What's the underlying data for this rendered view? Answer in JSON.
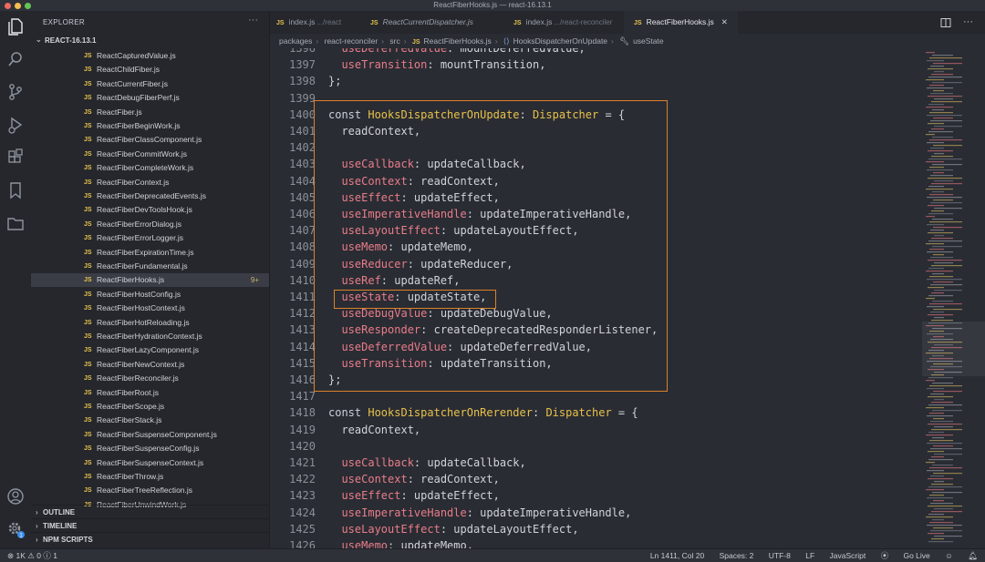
{
  "window": {
    "title": "ReactFiberHooks.js — react-16.13.1"
  },
  "sidebar": {
    "header": "EXPLORER",
    "folder": "REACT-16.13.1",
    "active_badge": "9+",
    "files": [
      "ReactCapturedValue.js",
      "ReactChildFiber.js",
      "ReactCurrentFiber.js",
      "ReactDebugFiberPerf.js",
      "ReactFiber.js",
      "ReactFiberBeginWork.js",
      "ReactFiberClassComponent.js",
      "ReactFiberCommitWork.js",
      "ReactFiberCompleteWork.js",
      "ReactFiberContext.js",
      "ReactFiberDeprecatedEvents.js",
      "ReactFiberDevToolsHook.js",
      "ReactFiberErrorDialog.js",
      "ReactFiberErrorLogger.js",
      "ReactFiberExpirationTime.js",
      "ReactFiberFundamental.js",
      "ReactFiberHooks.js",
      "ReactFiberHostConfig.js",
      "ReactFiberHostContext.js",
      "ReactFiberHotReloading.js",
      "ReactFiberHydrationContext.js",
      "ReactFiberLazyComponent.js",
      "ReactFiberNewContext.js",
      "ReactFiberReconciler.js",
      "ReactFiberRoot.js",
      "ReactFiberScope.js",
      "ReactFiberStack.js",
      "ReactFiberSuspenseComponent.js",
      "ReactFiberSuspenseConfig.js",
      "ReactFiberSuspenseContext.js",
      "ReactFiberThrow.js",
      "ReactFiberTreeReflection.js",
      "ReactFiberUnwindWork.js"
    ],
    "sections": [
      "OUTLINE",
      "TIMELINE",
      "NPM SCRIPTS"
    ],
    "file_prefix": "JS"
  },
  "tabs": [
    {
      "name": "index.js",
      "path": ".../react"
    },
    {
      "name": "ReactCurrentDispatcher.js",
      "path": ""
    },
    {
      "name": "index.js",
      "path": ".../react-reconciler"
    },
    {
      "name": "ReactFiberHooks.js",
      "path": ""
    }
  ],
  "breadcrumb": [
    "packages",
    "react-reconciler",
    "src",
    "ReactFiberHooks.js",
    "HooksDispatcherOnUpdate",
    "useState"
  ],
  "code": {
    "lines": [
      {
        "n": "1396",
        "parts": [
          [
            "key",
            "  useDeferredValue"
          ],
          [
            "op",
            ": mountDeferredValue,"
          ]
        ]
      },
      {
        "n": "1397",
        "parts": [
          [
            "key",
            "  useTransition"
          ],
          [
            "op",
            ": mountTransition,"
          ]
        ]
      },
      {
        "n": "1398",
        "parts": [
          [
            "op",
            "};"
          ]
        ]
      },
      {
        "n": "1399",
        "parts": []
      },
      {
        "n": "1400",
        "parts": [
          [
            "kw",
            "const "
          ],
          [
            "ty",
            "HooksDispatcherOnUpdate"
          ],
          [
            "op",
            ": "
          ],
          [
            "ty",
            "Dispatcher"
          ],
          [
            "op",
            " = {"
          ]
        ]
      },
      {
        "n": "1401",
        "parts": [
          [
            "op",
            "  readContext,"
          ]
        ]
      },
      {
        "n": "1402",
        "parts": []
      },
      {
        "n": "1403",
        "parts": [
          [
            "key",
            "  useCallback"
          ],
          [
            "op",
            ": updateCallback,"
          ]
        ]
      },
      {
        "n": "1404",
        "parts": [
          [
            "key",
            "  useContext"
          ],
          [
            "op",
            ": readContext,"
          ]
        ]
      },
      {
        "n": "1405",
        "parts": [
          [
            "key",
            "  useEffect"
          ],
          [
            "op",
            ": updateEffect,"
          ]
        ]
      },
      {
        "n": "1406",
        "parts": [
          [
            "key",
            "  useImperativeHandle"
          ],
          [
            "op",
            ": updateImperativeHandle,"
          ]
        ]
      },
      {
        "n": "1407",
        "parts": [
          [
            "key",
            "  useLayoutEffect"
          ],
          [
            "op",
            ": updateLayoutEffect,"
          ]
        ]
      },
      {
        "n": "1408",
        "parts": [
          [
            "key",
            "  useMemo"
          ],
          [
            "op",
            ": updateMemo,"
          ]
        ]
      },
      {
        "n": "1409",
        "parts": [
          [
            "key",
            "  useReducer"
          ],
          [
            "op",
            ": updateReducer,"
          ]
        ]
      },
      {
        "n": "1410",
        "parts": [
          [
            "key",
            "  useRef"
          ],
          [
            "op",
            ": updateRef,"
          ]
        ]
      },
      {
        "n": "1411",
        "parts": [
          [
            "key",
            "  useState"
          ],
          [
            "op",
            ": updateState,"
          ]
        ]
      },
      {
        "n": "1412",
        "parts": [
          [
            "key",
            "  useDebugValue"
          ],
          [
            "op",
            ": updateDebugValue,"
          ]
        ]
      },
      {
        "n": "1413",
        "parts": [
          [
            "key",
            "  useResponder"
          ],
          [
            "op",
            ": createDeprecatedResponderListener,"
          ]
        ]
      },
      {
        "n": "1414",
        "parts": [
          [
            "key",
            "  useDeferredValue"
          ],
          [
            "op",
            ": updateDeferredValue,"
          ]
        ]
      },
      {
        "n": "1415",
        "parts": [
          [
            "key",
            "  useTransition"
          ],
          [
            "op",
            ": updateTransition,"
          ]
        ]
      },
      {
        "n": "1416",
        "parts": [
          [
            "op",
            "};"
          ]
        ]
      },
      {
        "n": "1417",
        "parts": []
      },
      {
        "n": "1418",
        "parts": [
          [
            "kw",
            "const "
          ],
          [
            "ty",
            "HooksDispatcherOnRerender"
          ],
          [
            "op",
            ": "
          ],
          [
            "ty",
            "Dispatcher"
          ],
          [
            "op",
            " = {"
          ]
        ]
      },
      {
        "n": "1419",
        "parts": [
          [
            "op",
            "  readContext,"
          ]
        ]
      },
      {
        "n": "1420",
        "parts": []
      },
      {
        "n": "1421",
        "parts": [
          [
            "key",
            "  useCallback"
          ],
          [
            "op",
            ": updateCallback,"
          ]
        ]
      },
      {
        "n": "1422",
        "parts": [
          [
            "key",
            "  useContext"
          ],
          [
            "op",
            ": readContext,"
          ]
        ]
      },
      {
        "n": "1423",
        "parts": [
          [
            "key",
            "  useEffect"
          ],
          [
            "op",
            ": updateEffect,"
          ]
        ]
      },
      {
        "n": "1424",
        "parts": [
          [
            "key",
            "  useImperativeHandle"
          ],
          [
            "op",
            ": updateImperativeHandle,"
          ]
        ]
      },
      {
        "n": "1425",
        "parts": [
          [
            "key",
            "  useLayoutEffect"
          ],
          [
            "op",
            ": updateLayoutEffect,"
          ]
        ]
      },
      {
        "n": "1426",
        "parts": [
          [
            "key",
            "  useMemo"
          ],
          [
            "op",
            ": updateMemo,"
          ]
        ]
      }
    ]
  },
  "statusbar": {
    "errors": "1K",
    "warnings": "0",
    "info": "1",
    "position": "Ln 1411, Col 20",
    "spaces": "Spaces: 2",
    "encoding": "UTF-8",
    "eol": "LF",
    "language": "JavaScript",
    "golive": "Go Live"
  },
  "colors": {
    "highlight": "#d9822b",
    "js_icon": "#e8c24a",
    "property": "#e87d8a"
  },
  "icons": [
    "files-icon",
    "search-icon",
    "source-control-icon",
    "run-debug-icon",
    "extensions-icon",
    "bookmark-icon",
    "folder-icon",
    "account-icon",
    "settings-icon",
    "split-editor-icon",
    "more-icon"
  ]
}
